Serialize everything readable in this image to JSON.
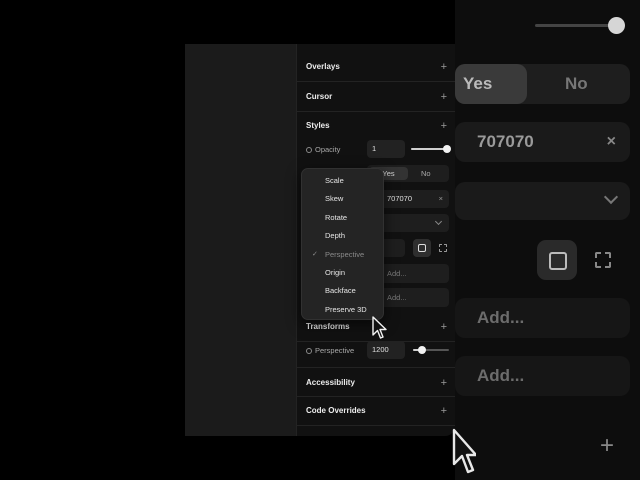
{
  "background_zoom": {
    "segment": {
      "on": "Yes",
      "off": "No"
    },
    "hex_value": "707070",
    "clear": "×",
    "add_placeholders": [
      "Add...",
      "Add..."
    ],
    "plus": "+"
  },
  "panel": {
    "sections": {
      "overlays": "Overlays",
      "cursor": "Cursor",
      "styles": "Styles",
      "transforms": "Transforms",
      "accessibility": "Accessibility",
      "code_overrides": "Code Overrides"
    },
    "plus": "+",
    "opacity": {
      "label": "Opacity",
      "value": "1",
      "slider_fraction": 1.0
    },
    "visible_segment": {
      "on": "Yes",
      "off": "No"
    },
    "fill": {
      "value": "707070",
      "clear": "×"
    },
    "add_placeholder_1": "Add...",
    "add_placeholder_2": "Add...",
    "perspective": {
      "label": "Perspective",
      "value": "1200",
      "slider_fraction": 0.25
    }
  },
  "dropdown": {
    "items": [
      {
        "label": "Scale",
        "checked": false
      },
      {
        "label": "Skew",
        "checked": false
      },
      {
        "label": "Rotate",
        "checked": false
      },
      {
        "label": "Depth",
        "checked": false
      },
      {
        "label": "Perspective",
        "checked": true
      },
      {
        "label": "Origin",
        "checked": false
      },
      {
        "label": "Backface",
        "checked": false
      },
      {
        "label": "Preserve 3D",
        "checked": false
      }
    ],
    "check_glyph": "✓"
  },
  "colors": {
    "panel_bg": "#111111",
    "menu_bg": "#242424",
    "accent_text": "#ededed"
  }
}
